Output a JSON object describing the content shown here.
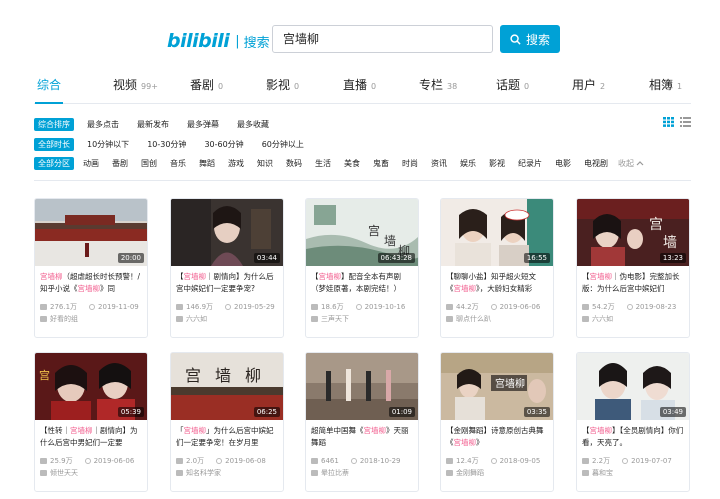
{
  "header": {
    "logo_text": "bilibili",
    "logo_suffix": "搜索",
    "search_value": "宫墙柳",
    "search_button": "搜索"
  },
  "tabs": [
    {
      "label": "综合",
      "count": ""
    },
    {
      "label": "视频",
      "count": "99+"
    },
    {
      "label": "番剧",
      "count": "0"
    },
    {
      "label": "影视",
      "count": "0"
    },
    {
      "label": "直播",
      "count": "0"
    },
    {
      "label": "专栏",
      "count": "38"
    },
    {
      "label": "话题",
      "count": "0"
    },
    {
      "label": "用户",
      "count": "2"
    },
    {
      "label": "相簿",
      "count": "1"
    }
  ],
  "filters": {
    "sort": {
      "chip": "综合排序",
      "options": [
        "最多点击",
        "最新发布",
        "最多弹幕",
        "最多收藏"
      ]
    },
    "duration": {
      "chip": "全部时长",
      "options": [
        "10分钟以下",
        "10-30分钟",
        "30-60分钟",
        "60分钟以上"
      ]
    },
    "zone": {
      "chip": "全部分区",
      "options": [
        "动画",
        "番剧",
        "国创",
        "音乐",
        "舞蹈",
        "游戏",
        "知识",
        "数码",
        "生活",
        "美食",
        "鬼畜",
        "时尚",
        "资讯",
        "娱乐",
        "影视",
        "纪录片",
        "电影",
        "电视剧"
      ],
      "collapse": "收起"
    }
  },
  "videos": [
    {
      "duration": "20:00",
      "title_pre": "",
      "title_hl": "宫墙柳",
      "title_post": "（超虐超长时长预警！/知乎小说《",
      "title_hl2": "宫墙柳",
      "title_post2": "》同",
      "views": "276.1万",
      "date": "2019-11-09",
      "uploader": "好看的组"
    },
    {
      "duration": "03:44",
      "title_pre": "【",
      "title_hl": "宫墙柳",
      "title_post": "｜剧情向】为什么后宫中嫔妃们一定要争宠?",
      "title_hl2": "",
      "title_post2": "",
      "views": "146.9万",
      "date": "2019-05-29",
      "uploader": "六六如"
    },
    {
      "duration": "06:43:28",
      "title_pre": "【",
      "title_hl": "宫墙柳",
      "title_post": "】配音全本有声剧（梦娃原著，本剧完结！）",
      "title_hl2": "",
      "title_post2": "",
      "views": "18.6万",
      "date": "2019-10-16",
      "uploader": "三声天下"
    },
    {
      "duration": "16:55",
      "title_pre": "【聊聊小盐】知乎超火短文《",
      "title_hl": "宫墙柳",
      "title_post": "》，大龄妇女精彩",
      "title_hl2": "",
      "title_post2": "",
      "views": "44.2万",
      "date": "2019-06-06",
      "uploader": "聊点什么趴"
    },
    {
      "duration": "13:23",
      "title_pre": "【",
      "title_hl": "宫墙柳",
      "title_post": "｜伪电影】完整加长版：为什么后宫中嫔妃们",
      "title_hl2": "",
      "title_post2": "",
      "views": "54.2万",
      "date": "2019-08-23",
      "uploader": "六六如"
    },
    {
      "duration": "05:39",
      "title_pre": "【性转｜",
      "title_hl": "宫墙柳",
      "title_post": "｜剧情向】为什么后宫中男妃们一定要",
      "title_hl2": "",
      "title_post2": "",
      "views": "25.9万",
      "date": "2019-06-06",
      "uploader": "倾世天天"
    },
    {
      "duration": "06:25",
      "title_pre": "「",
      "title_hl": "宫墙柳",
      "title_post": "」为什么后宫中嫔妃们一定要争宠！在岁月里",
      "title_hl2": "",
      "title_post2": "",
      "views": "2.0万",
      "date": "2019-06-08",
      "uploader": "知名科学家"
    },
    {
      "duration": "01:09",
      "title_pre": "超简单中国舞《",
      "title_hl": "宫墙柳",
      "title_post": "》天丽舞蹈",
      "title_hl2": "",
      "title_post2": "",
      "views": "6461",
      "date": "2018-10-29",
      "uploader": "晕拉比萘"
    },
    {
      "duration": "03:35",
      "title_pre": "【金刚舞蹈】诗意原创古典舞《",
      "title_hl": "宫墙柳",
      "title_post": "》",
      "title_hl2": "",
      "title_post2": "",
      "views": "12.4万",
      "date": "2018-09-05",
      "uploader": "金刚舞蹈"
    },
    {
      "duration": "03:49",
      "title_pre": "【",
      "title_hl": "宫墙柳",
      "title_post": "】【全员剧情向】你们看，天亮了。",
      "title_hl2": "",
      "title_post2": "",
      "views": "2.2万",
      "date": "2019-07-07",
      "uploader": "暮和宝"
    }
  ],
  "colors": {
    "accent": "#00a1d6",
    "highlight": "#f25d8e"
  }
}
